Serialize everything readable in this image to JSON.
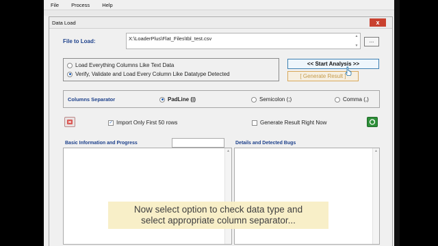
{
  "menu": {
    "items": [
      "File",
      "Process",
      "Help"
    ]
  },
  "dialog": {
    "title": "Data Load",
    "close_glyph": "x",
    "file_label": "File to Load:",
    "file_path": "X:\\LoaderPlus\\Flat_Files\\tbl_test.csv",
    "browse_label": "...",
    "load_options": [
      "Load Everything Columns Like Text Data",
      "Verify, Validate and Load Every Column Like Datatype Detected"
    ],
    "start_button": "<< Start Analysis >>",
    "generate_button": "[ Generate Result ]",
    "separator": {
      "label": "Columns Separator",
      "options": [
        "PadLine (|)",
        "Semicolon (;)",
        "Comma (,)"
      ]
    },
    "import_first_rows": "Import Only First 50 rows",
    "generate_now": "Generate Result Right Now",
    "basic_info_label": "Basic Information and Progress",
    "details_label": "Details and Detected Bugs"
  },
  "caption": {
    "line1": "Now select option to check data type and",
    "line2": "select appropriate column separator..."
  },
  "colors": {
    "title_accent": "#1b3f8a",
    "close_red": "#c9412f",
    "start_border": "#3c7fb1",
    "generate_orange": "#d7a75a",
    "caption_bg": "#f8eec4"
  }
}
